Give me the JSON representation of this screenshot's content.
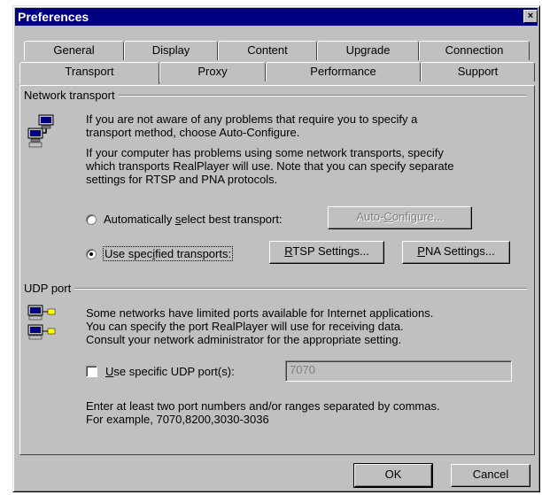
{
  "window": {
    "title": "Preferences",
    "close_glyph": "×"
  },
  "tabs": {
    "row1": [
      "General",
      "Display",
      "Content",
      "Upgrade",
      "Connection"
    ],
    "row2": [
      "Transport",
      "Proxy",
      "Performance",
      "Support"
    ],
    "active": "Transport"
  },
  "network_transport": {
    "group_label": "Network transport",
    "icon": "network-computers-icon",
    "para1_line1": "If you are not aware of any problems that require you to specify a",
    "para1_line2": "transport method, choose Auto-Configure.",
    "para2_line1": "If your computer has problems using some network transports, specify",
    "para2_line2": "which transports RealPlayer will use. Note that you can specify separate",
    "para2_line3": "settings for RTSP and PNA protocols.",
    "auto_radio": {
      "pre": "Automatically ",
      "ul": "s",
      "post": "elect best transport:",
      "selected": false
    },
    "auto_configure_button": {
      "pre": "Auto-",
      "ul": "C",
      "post": "onfigure...",
      "enabled": false
    },
    "specified_radio": {
      "pre": "Use spec",
      "ul": "i",
      "post": "fied transports:",
      "selected": true
    },
    "rtsp_button": {
      "ul": "R",
      "post": "TSP Settings..."
    },
    "pna_button": {
      "ul": "P",
      "post": "NA Settings..."
    }
  },
  "udp_port": {
    "group_label": "UDP port",
    "icon": "network-port-icon",
    "para_line1": "Some networks have limited ports available for Internet applications.",
    "para_line2": "You can specify the port RealPlayer will use for receiving data.",
    "para_line3": "Consult your network administrator for the appropriate setting.",
    "checkbox": {
      "ul": "U",
      "post": "se specific UDP port(s):",
      "checked": false
    },
    "port_value": "7070",
    "hint_line1": "Enter at least two port numbers and/or ranges separated by commas.",
    "hint_line2": "For example, 7070,8200,3030-3036"
  },
  "footer": {
    "ok_label": "OK",
    "cancel_label": "Cancel"
  },
  "colors": {
    "face": "#c0c0c0",
    "titlebar": "#000080",
    "disabled_text": "#808080"
  }
}
